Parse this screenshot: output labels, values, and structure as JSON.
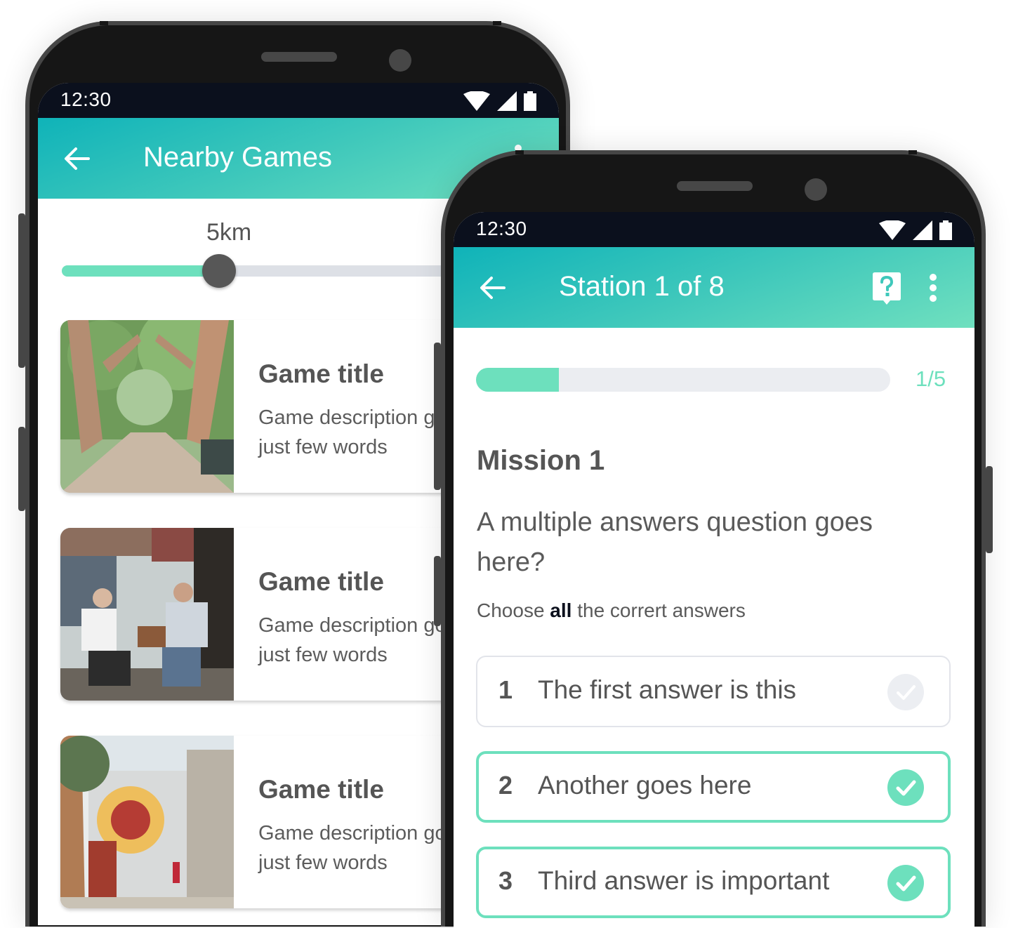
{
  "colors": {
    "accent": "#6de0bd",
    "appbar_start": "#0fb3b9",
    "appbar_end": "#70e0bf",
    "statusbar": "#0b101d",
    "device_frame": "#161616",
    "text_primary": "#555555",
    "track": "#dde0e6"
  },
  "left_phone": {
    "status": {
      "time": "12:30",
      "icons": [
        "wifi-icon",
        "signal-icon",
        "battery-icon"
      ]
    },
    "appbar": {
      "back_icon": "arrow-left-icon",
      "title": "Nearby Games",
      "menu_icon": "more-vert-icon"
    },
    "distance_slider": {
      "label": "5km",
      "value_fraction": 0.32
    },
    "games": [
      {
        "image": "tree-lined-boulevard-photo",
        "title": "Game title",
        "description": "Game description goes here, just few words"
      },
      {
        "image": "men-playing-backgammon-photo",
        "title": "Game title",
        "description": "Game description goes here, just few words"
      },
      {
        "image": "emergency-stop-mural-photo",
        "title": "Game title",
        "description": "Game description goes here, just few words"
      }
    ]
  },
  "right_phone": {
    "status": {
      "time": "12:30",
      "icons": [
        "wifi-icon",
        "signal-icon",
        "battery-icon"
      ]
    },
    "appbar": {
      "back_icon": "arrow-left-icon",
      "title": "Station 1 of 8",
      "help_icon": "help-bubble-icon",
      "menu_icon": "more-vert-icon"
    },
    "progress": {
      "current": 1,
      "total": 5,
      "label": "1/5"
    },
    "mission_title": "Mission 1",
    "question": "A multiple answers question goes here?",
    "hint": {
      "prefix": "Choose ",
      "emphasis": "all",
      "suffix": " the corrert answers"
    },
    "answers": [
      {
        "number": "1",
        "text": "The first answer is this",
        "selected": false
      },
      {
        "number": "2",
        "text": "Another goes here",
        "selected": true
      },
      {
        "number": "3",
        "text": "Third answer is important",
        "selected": true
      }
    ]
  }
}
